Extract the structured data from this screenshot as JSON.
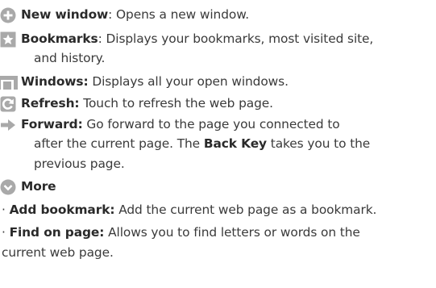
{
  "items": [
    {
      "icon": "new-window-icon",
      "label": "New window",
      "sep": ":",
      "desc": " Opens a new window."
    },
    {
      "icon": "bookmarks-icon",
      "label": "Bookmarks",
      "sep": ":",
      "desc": " Displays your bookmarks, most visited site,",
      "cont": [
        "and history."
      ]
    },
    {
      "icon": "windows-icon",
      "label": "Windows:",
      "sep": "",
      "desc": " Displays all your open windows."
    },
    {
      "icon": "refresh-icon",
      "label": "Refresh:",
      "sep": "",
      "desc": " Touch to refresh the web page."
    },
    {
      "icon": "forward-icon",
      "label": "Forward:",
      "sep": "",
      "desc": " Go forward to the page you connected to",
      "cont_pre": "after the current page. The ",
      "cont_bold": "Back Key",
      "cont_post": " takes you to the",
      "cont2": "previous page."
    },
    {
      "icon": "more-icon",
      "label": "More"
    }
  ],
  "bullets": [
    {
      "label": "Add bookmark:",
      "desc": " Add the current web page as a bookmark."
    },
    {
      "label": "Find on page:",
      "desc": " Allows you to find letters or words on the",
      "cont": "current web page."
    }
  ],
  "bullet_char": "·",
  "colors": {
    "icon_fill": "#a9a9a9",
    "text": "#3a3a3a"
  }
}
